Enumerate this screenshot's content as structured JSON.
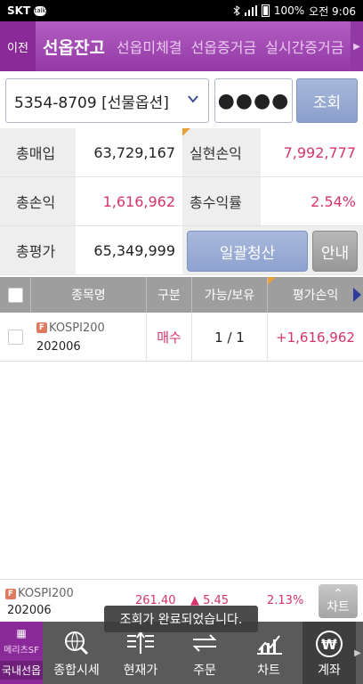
{
  "status": {
    "carrier": "SKT",
    "chat_icon_text": "talk",
    "battery": "100%",
    "time": "오전 9:06"
  },
  "tabs": {
    "back_label": "이전",
    "items": [
      {
        "label": "선옵잔고",
        "active": true
      },
      {
        "label": "선옵미체결",
        "active": false
      },
      {
        "label": "선옵증거금",
        "active": false
      },
      {
        "label": "실시간증거금",
        "active": false
      }
    ]
  },
  "account": {
    "selected": "5354-8709 [선물옵션]",
    "password_mask": "●●●●",
    "query_label": "조회"
  },
  "summary": {
    "total_buy_label": "총매입",
    "total_buy_value": "63,729,167",
    "realized_label": "실현손익",
    "realized_value": "7,992,777",
    "total_pl_label": "총손익",
    "total_pl_value": "1,616,962",
    "total_rate_label": "총수익률",
    "total_rate_value": "2.54%",
    "total_eval_label": "총평가",
    "total_eval_value": "65,349,999",
    "liquidate_label": "일괄청산",
    "guide_label": "안내"
  },
  "table": {
    "headers": {
      "name": "종목명",
      "type": "구분",
      "qty": "가능/보유",
      "pl": "평가손익"
    },
    "rows": [
      {
        "badge": "F",
        "name": "KOSPI200",
        "code": "202006",
        "type": "매수",
        "qty": "1 / 1",
        "pl": "+1,616,962"
      }
    ]
  },
  "ticker": {
    "badge": "F",
    "name": "KOSPI200",
    "code": "202006",
    "price": "261.40",
    "change": "▲ 5.45",
    "pct": "2.13%",
    "chart_label": "차트",
    "chart_arrow": "⌃"
  },
  "toast": "조회가 완료되었습니다.",
  "bottom_nav": {
    "brand_logo": "메리츠SF",
    "brand_label": "국내선옵",
    "items": [
      {
        "label": "종합시세",
        "icon": "globe-search-icon"
      },
      {
        "label": "현재가",
        "icon": "orderbook-icon"
      },
      {
        "label": "주문",
        "icon": "exchange-arrows-icon"
      },
      {
        "label": "차트",
        "icon": "chart-icon"
      },
      {
        "label": "계좌",
        "icon": "won-coin-icon",
        "active": true
      }
    ]
  },
  "colors": {
    "brand_purple": "#9339a6",
    "positive_red": "#d6336c",
    "button_blue": "#8ea2cf"
  }
}
